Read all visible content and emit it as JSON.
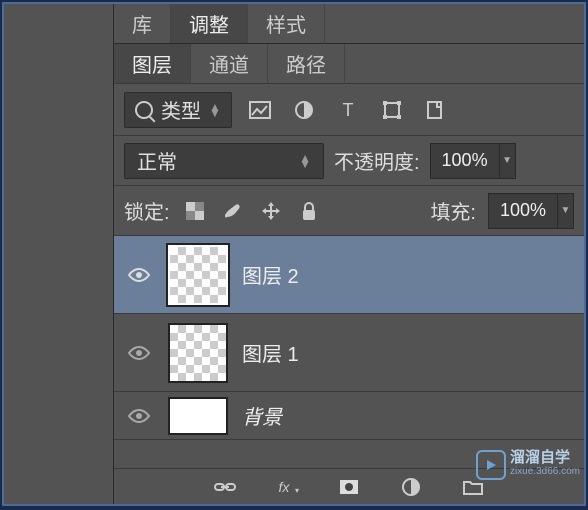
{
  "topTabs": {
    "library": "库",
    "adjust": "调整",
    "styles": "样式"
  },
  "panelTabs": {
    "layers": "图层",
    "channels": "通道",
    "paths": "路径"
  },
  "filter": {
    "label": "类型"
  },
  "blend": {
    "mode": "正常",
    "opacityLabel": "不透明度:",
    "opacityValue": "100%"
  },
  "lock": {
    "label": "锁定:",
    "fillLabel": "填充:",
    "fillValue": "100%"
  },
  "layers": [
    {
      "name": "图层 2",
      "selected": true,
      "checker": true
    },
    {
      "name": "图层 1",
      "selected": false,
      "checker": true
    },
    {
      "name": "背景",
      "selected": false,
      "checker": false,
      "bg": true
    }
  ],
  "watermark": {
    "title": "溜溜自学",
    "sub": "zixue.3d66.com"
  }
}
